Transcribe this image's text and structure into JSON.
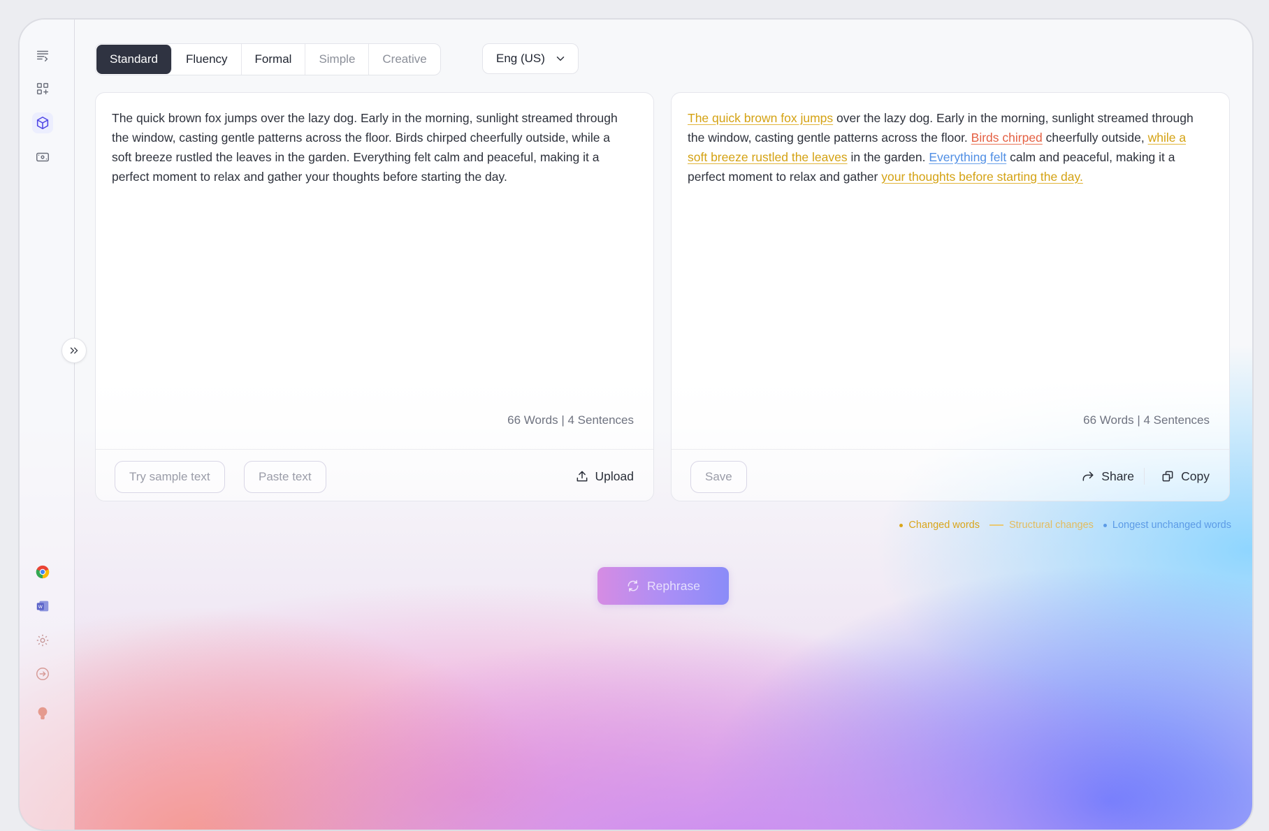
{
  "sidebar": {
    "top_icons": [
      "paraphrase-icon",
      "apps-grid-icon",
      "cube-icon",
      "ticket-icon"
    ],
    "bottom_icons": [
      "chrome-icon",
      "word-icon",
      "settings-icon",
      "login-icon",
      "avatar"
    ]
  },
  "modes": {
    "items": [
      "Standard",
      "Fluency",
      "Formal",
      "Simple",
      "Creative"
    ],
    "active": "Standard"
  },
  "language": {
    "selected": "Eng (US)"
  },
  "input_panel": {
    "text": "The quick brown fox jumps over the lazy dog. Early in the morning, sunlight streamed through the window, casting gentle patterns across the floor. Birds chirped cheerfully outside, while a soft breeze rustled the leaves in the garden. Everything felt calm and peaceful, making it a perfect moment to relax and gather your thoughts before starting the day.",
    "stats": "66 Words | 4 Sentences",
    "try_sample_label": "Try sample text",
    "paste_label": "Paste text",
    "upload_label": "Upload"
  },
  "output_panel": {
    "segments": [
      {
        "text": "The quick brown fox jumps",
        "type": "changed"
      },
      {
        "text": " over the lazy dog. Early in the morning, sunlight streamed through the window, casting gentle patterns across the floor. ",
        "type": "plain"
      },
      {
        "text": "Birds chirped",
        "type": "structural"
      },
      {
        "text": " cheerfully outside, ",
        "type": "plain"
      },
      {
        "text": "while a soft breeze rustled the leaves",
        "type": "changed"
      },
      {
        "text": " in the garden. ",
        "type": "plain"
      },
      {
        "text": "Everything felt",
        "type": "unchanged"
      },
      {
        "text": " calm and peaceful, making it a perfect moment to relax and gather ",
        "type": "plain"
      },
      {
        "text": "your thoughts before starting the day.",
        "type": "changed"
      }
    ],
    "stats": "66 Words | 4 Sentences",
    "save_label": "Save",
    "share_label": "Share",
    "copy_label": "Copy"
  },
  "legend": {
    "changed": "Changed words",
    "structural": "Structural changes",
    "unchanged": "Longest unchanged words"
  },
  "rephrase_label": "Rephrase",
  "colors": {
    "changed": "#d4a213",
    "structural": "#e46043",
    "unchanged": "#4f8ee4",
    "active_mode": "#2f3341"
  }
}
